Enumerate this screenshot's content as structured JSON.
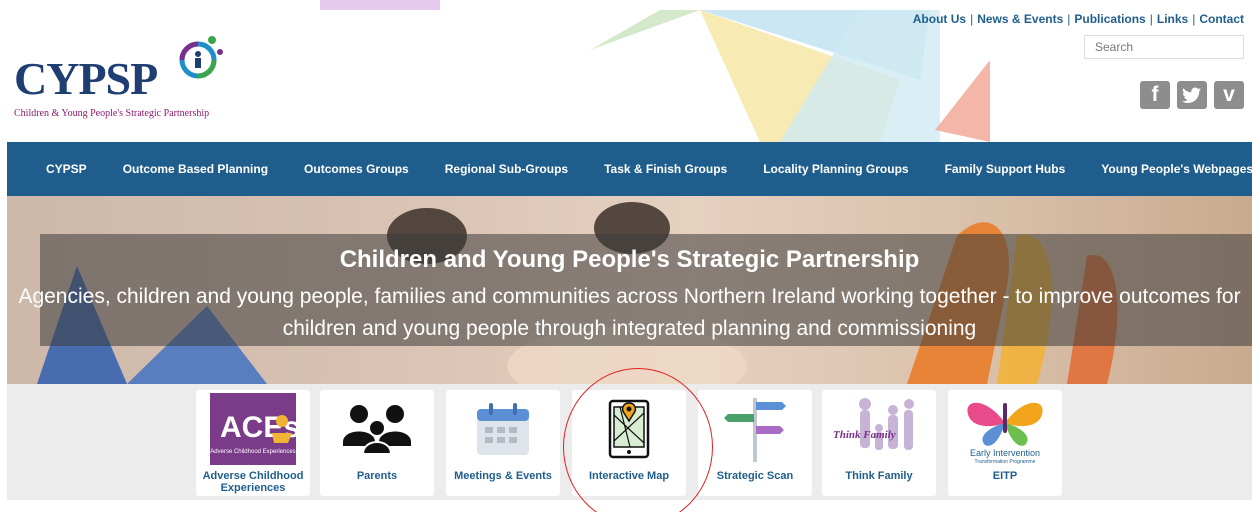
{
  "header": {
    "logo_text": "CYPSP",
    "logo_subtitle": "Children & Young People's Strategic Partnership",
    "top_links": [
      "About Us",
      "News & Events",
      "Publications",
      "Links",
      "Contact"
    ],
    "search_placeholder": "Search",
    "social": [
      {
        "glyph": "f",
        "icon": "facebook-icon"
      },
      {
        "glyph": "t",
        "icon": "twitter-icon"
      },
      {
        "glyph": "v",
        "icon": "vimeo-icon"
      }
    ]
  },
  "nav": {
    "items": [
      "CYPSP",
      "Outcome Based Planning",
      "Outcomes Groups",
      "Regional Sub-Groups",
      "Task & Finish Groups",
      "Locality Planning Groups",
      "Family Support Hubs",
      "Young People's Webpages"
    ]
  },
  "hero": {
    "title": "Children and Young People's Strategic Partnership",
    "subtitle": "Agencies, children and young people, families and communities across Northern Ireland working together - to improve outcomes for children and young people through integrated planning and commissioning"
  },
  "tiles": [
    {
      "label": "Adverse Childhood Experiences",
      "icon": "aces-logo-icon",
      "logo_text": "ACEs",
      "logo_caption": "Adverse Childhood Experiences"
    },
    {
      "label": "Parents",
      "icon": "parents-icon"
    },
    {
      "label": "Meetings & Events",
      "icon": "calendar-icon"
    },
    {
      "label": "Interactive Map",
      "icon": "map-tablet-icon"
    },
    {
      "label": "Strategic Scan",
      "icon": "signpost-icon"
    },
    {
      "label": "Think Family",
      "icon": "family-silhouette-icon",
      "logo_text": "Think Family"
    },
    {
      "label": "EITP",
      "icon": "butterfly-icon",
      "logo_text": "Early Intervention",
      "logo_caption": "Transformation Programme"
    }
  ],
  "colors": {
    "brand_blue": "#1f5e8c",
    "logo_navy": "#1f3f73",
    "logo_purple": "#8a1c70",
    "highlight_red": "#e02020"
  }
}
